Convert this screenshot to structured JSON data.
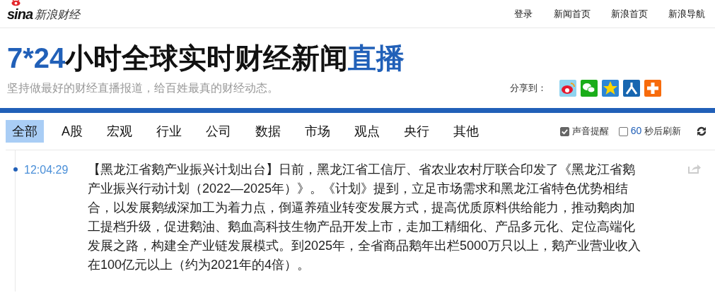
{
  "header": {
    "logo_mark": "sina",
    "logo_text": "新浪财经",
    "links": [
      "登录",
      "新闻首页",
      "新浪首页",
      "新浪导航"
    ]
  },
  "title": {
    "highlight": "7*24",
    "main": "小时全球实时财经新闻",
    "tail": "直播"
  },
  "subtitle": "坚持做最好的财经直播报道，给百姓最真的财经动态。",
  "share": {
    "label": "分享到：",
    "targets": [
      {
        "kind": "weibo"
      },
      {
        "kind": "wechat"
      },
      {
        "kind": "qzone"
      },
      {
        "kind": "renren"
      },
      {
        "kind": "more"
      }
    ]
  },
  "tabs": [
    {
      "label": "全部",
      "selected": true
    },
    {
      "label": "A股",
      "selected": false
    },
    {
      "label": "宏观",
      "selected": false
    },
    {
      "label": "行业",
      "selected": false
    },
    {
      "label": "公司",
      "selected": false
    },
    {
      "label": "数据",
      "selected": false
    },
    {
      "label": "市场",
      "selected": false
    },
    {
      "label": "观点",
      "selected": false
    },
    {
      "label": "央行",
      "selected": false
    },
    {
      "label": "其他",
      "selected": false
    }
  ],
  "sound_alert": {
    "label": "声音提醒",
    "checked": true
  },
  "auto_refresh": {
    "seconds": "60",
    "label": "秒后刷新",
    "checked": false
  },
  "news": [
    {
      "time": "12:04:29",
      "text": "【黑龙江省鹅产业振兴计划出台】日前，黑龙江省工信厅、省农业农村厅联合印发了《黑龙江省鹅产业振兴行动计划（2022—2025年）》。《计划》提到，立足市场需求和黑龙江省特色优势相结合，以发展鹅绒深加工为着力点，倒逼养殖业转变发展方式，提高优质原料供给能力，推动鹅肉加工提档升级，促进鹅油、鹅血高科技生物产品开发上市，走加工精细化、产品多元化、定位高端化发展之路，构建全产业链发展模式。到2025年，全省商品鹅年出栏5000万只以上，鹅产业营业收入在100亿元以上（约为2021年的4倍）。"
    }
  ]
}
